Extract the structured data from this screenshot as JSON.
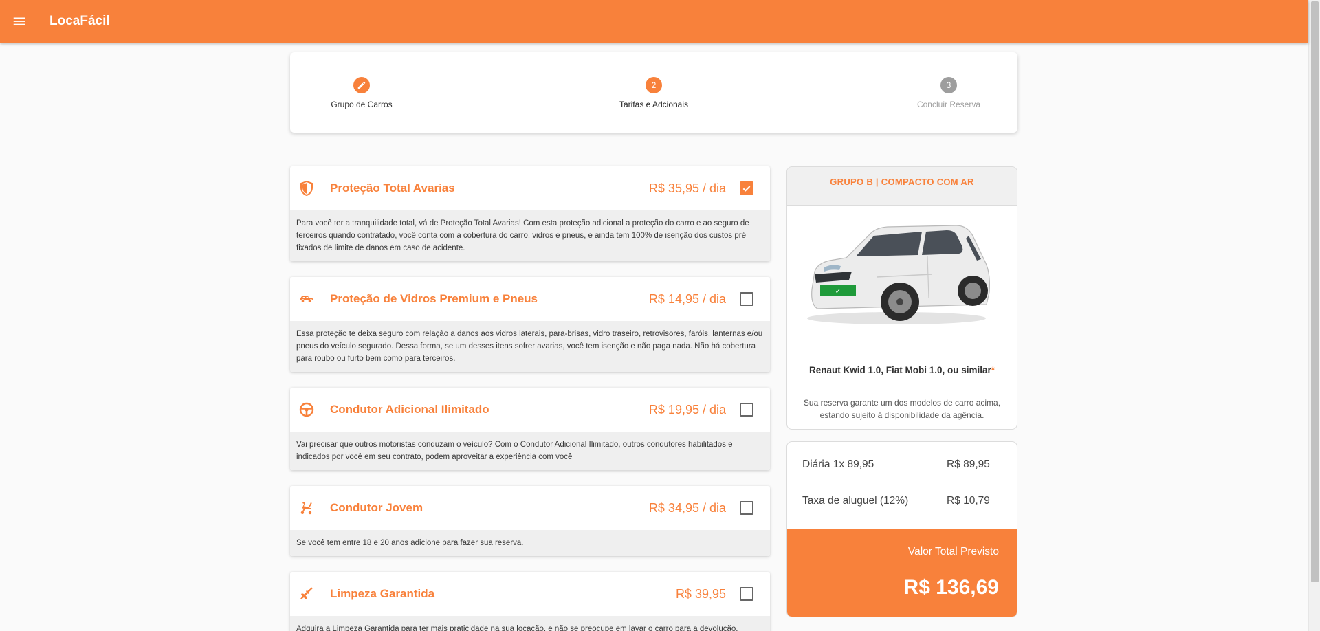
{
  "colors": {
    "accent": "#f8813b"
  },
  "appbar": {
    "title": "LocaFácil",
    "menu_icon": "menu-icon"
  },
  "stepper": {
    "steps": [
      {
        "label": "Grupo de Carros",
        "state": "done",
        "icon": "pencil-icon"
      },
      {
        "label": "Tarifas e Adcionais",
        "number": "2",
        "state": "active"
      },
      {
        "label": "Concluir Reserva",
        "number": "3",
        "state": "pending"
      }
    ]
  },
  "addons": [
    {
      "title": "Proteção Total Avarias",
      "price": "R$ 35,95 / dia",
      "checked": true,
      "icon": "shield-icon",
      "description": "Para você ter a tranquilidade total, vá de Proteção Total Avarias! Com esta proteção adicional a proteção do carro e ao seguro de terceiros quando contratado, você conta com a cobertura do carro, vidros e pneus, e ainda tem 100% de isenção dos custos pré fixados de limite de danos em caso de acidente."
    },
    {
      "title": "Proteção de Vidros Premium e Pneus",
      "price": "R$ 14,95 / dia",
      "checked": false,
      "icon": "car-icon",
      "description": "Essa proteção te deixa seguro com relação a danos aos vidros laterais, para-brisas, vidro traseiro, retrovisores, faróis, lanternas e/ou pneus do veículo segurado. Dessa forma, se um desses itens sofrer avarias, você tem isenção e não paga nada. Não há cobertura para roubo ou furto bem como para terceiros."
    },
    {
      "title": "Condutor Adicional Ilimitado",
      "price": "R$ 19,95 / dia",
      "checked": false,
      "icon": "steering-wheel-icon",
      "description": "Vai precisar que outros motoristas conduzam o veículo? Com o Condutor Adicional Ilimitado, outros condutores habilitados e indicados por você em seu contrato, podem aproveitar a experiência com você"
    },
    {
      "title": "Condutor Jovem",
      "price": "R$ 34,95 / dia",
      "checked": false,
      "icon": "stroller-icon",
      "description": "Se você tem entre 18 e 20 anos adicione para fazer sua reserva."
    },
    {
      "title": "Limpeza Garantida",
      "price": "R$ 39,95",
      "checked": false,
      "icon": "broom-icon",
      "description": "Adquira a Limpeza Garantida para ter mais praticidade na sua locação, e não se preocupe em lavar o carro para a devolução."
    }
  ],
  "car": {
    "group": "GRUPO B | COMPACTO COM AR",
    "models": "Renaut Kwid 1.0, Fiat Mobi 1.0, ou similar",
    "models_mark": "*",
    "note": "Sua reserva garante um dos modelos de carro acima, estando sujeito à disponibilidade da agência."
  },
  "pricing": {
    "rows": [
      {
        "label": "Diária 1x 89,95",
        "value": "R$ 89,95"
      },
      {
        "label": "Taxa de aluguel (12%)",
        "value": "R$ 10,79"
      }
    ],
    "total_label": "Valor Total Previsto",
    "total_value": "R$ 136,69"
  }
}
